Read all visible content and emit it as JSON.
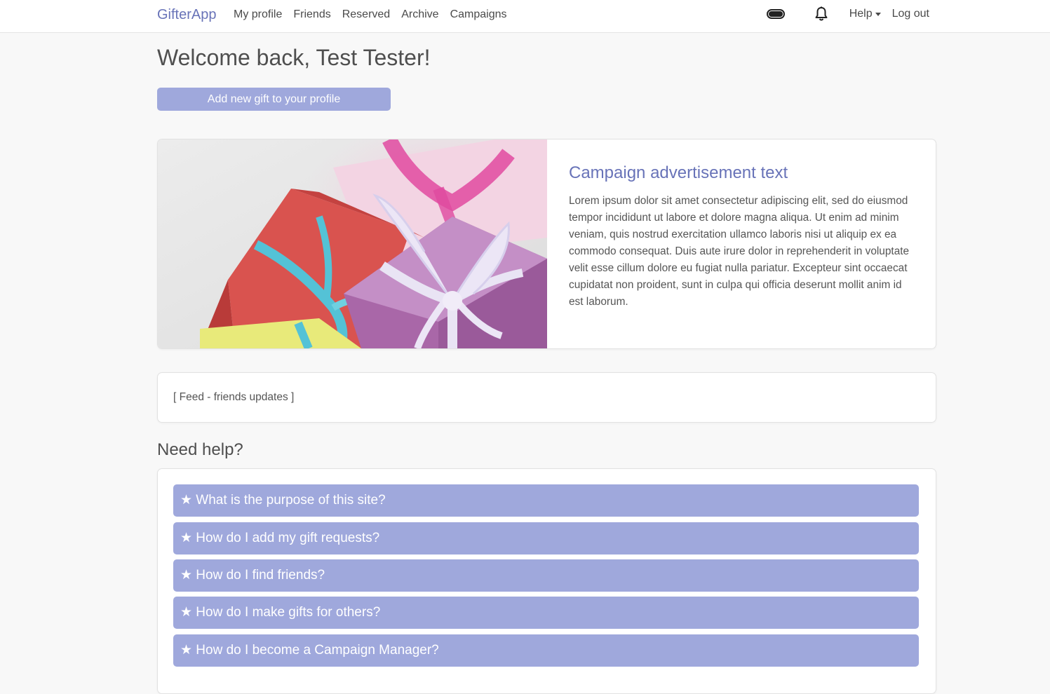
{
  "nav": {
    "brand": "GifterApp",
    "links": [
      "My profile",
      "Friends",
      "Reserved",
      "Archive",
      "Campaigns"
    ],
    "help": "Help",
    "logout": "Log out"
  },
  "welcome": "Welcome back, Test Tester!",
  "add_gift_button": "Add new gift to your profile",
  "campaign": {
    "title": "Campaign advertisement text",
    "body": "Lorem ipsum dolor sit amet consectetur adipiscing elit, sed do eiusmod tempor incididunt ut labore et dolore magna aliqua. Ut enim ad minim veniam, quis nostrud exercitation ullamco laboris nisi ut aliquip ex ea commodo consequat. Duis aute irure dolor in reprehenderit in voluptate velit esse cillum dolore eu fugiat nulla pariatur. Excepteur sint occaecat cupidatat non proident, sunt in culpa qui officia deserunt mollit anim id est laborum."
  },
  "feed": "[ Feed - friends updates ]",
  "help_section": {
    "heading": "Need help?",
    "faq": [
      "★ What is the purpose of this site?",
      "★ How do I add my gift requests?",
      "★ How do I find friends?",
      "★ How do I make gifts for others?",
      "★ How do I become a Campaign Manager?"
    ]
  },
  "colors": {
    "accent": "#6873b8",
    "button": "#9fa8dc",
    "background": "#f8f8f8"
  }
}
